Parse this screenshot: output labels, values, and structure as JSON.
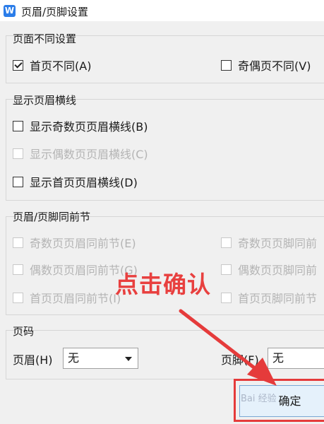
{
  "window": {
    "title": "页眉/页脚设置",
    "icon": "wps-writer-icon"
  },
  "page_diff": {
    "title": "页面不同设置",
    "first_page": {
      "label": "首页不同(A)",
      "checked": true
    },
    "odd_even": {
      "label": "奇偶页不同(V)",
      "checked": false
    }
  },
  "header_line": {
    "title": "显示页眉横线",
    "odd": {
      "label": "显示奇数页页眉横线(B)",
      "checked": false,
      "enabled": true
    },
    "even": {
      "label": "显示偶数页页眉横线(C)",
      "checked": false,
      "enabled": false
    },
    "first": {
      "label": "显示首页页眉横线(D)",
      "checked": false,
      "enabled": true
    }
  },
  "same_as_prev": {
    "title": "页眉/页脚同前节",
    "odd_header": {
      "label": "奇数页页眉同前节(E)",
      "enabled": false
    },
    "even_header": {
      "label": "偶数页页眉同前节(G)",
      "enabled": false
    },
    "first_header": {
      "label": "首页页眉同前节(I)",
      "enabled": false
    },
    "odd_footer": {
      "label": "奇数页页脚同前",
      "enabled": false
    },
    "even_footer": {
      "label": "偶数页页脚同前",
      "enabled": false
    },
    "first_footer": {
      "label": "首页页脚同前节",
      "enabled": false
    }
  },
  "page_number": {
    "title": "页码",
    "header_label": "页眉(H)",
    "header_value": "无",
    "footer_label": "页脚(F)",
    "footer_value": "无"
  },
  "buttons": {
    "ok": "确定"
  },
  "annotation": {
    "text": "点击确认",
    "color": "#e8403f"
  },
  "watermark": "Bai 经验"
}
